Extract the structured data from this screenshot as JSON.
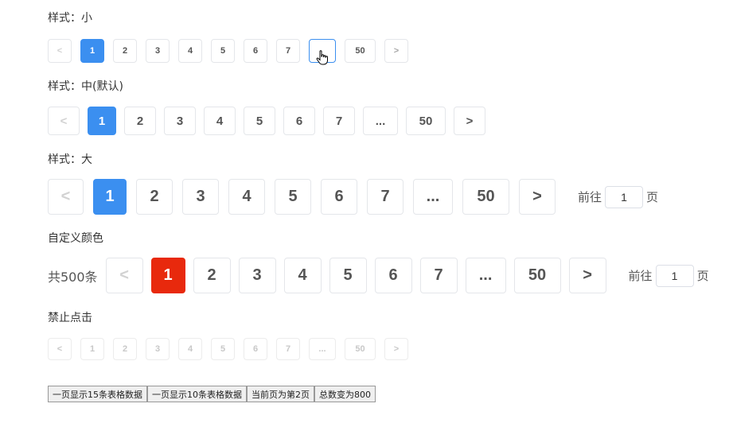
{
  "sections": {
    "small": {
      "label": "样式：小",
      "prev": "<",
      "next": ">",
      "pages": [
        "1",
        "2",
        "3",
        "4",
        "5",
        "6",
        "7",
        "",
        "50"
      ],
      "active": "1"
    },
    "medium": {
      "label": "样式：中(默认)",
      "prev": "<",
      "next": ">",
      "pages": [
        "1",
        "2",
        "3",
        "4",
        "5",
        "6",
        "7",
        "...",
        "50"
      ],
      "active": "1"
    },
    "large": {
      "label": "样式：大",
      "prev": "<",
      "next": ">",
      "pages": [
        "1",
        "2",
        "3",
        "4",
        "5",
        "6",
        "7",
        "...",
        "50"
      ],
      "active": "1",
      "goto_prefix": "前往",
      "goto_value": "1",
      "goto_suffix": "页"
    },
    "custom": {
      "label": "自定义颜色",
      "total": "共500条",
      "prev": "<",
      "next": ">",
      "pages": [
        "1",
        "2",
        "3",
        "4",
        "5",
        "6",
        "7",
        "...",
        "50"
      ],
      "active": "1",
      "active_color": "#e8290d",
      "goto_prefix": "前往",
      "goto_value": "1",
      "goto_suffix": "页"
    },
    "disabled": {
      "label": "禁止点击",
      "prev": "<",
      "next": ">",
      "pages": [
        "1",
        "2",
        "3",
        "4",
        "5",
        "6",
        "7",
        "...",
        "50"
      ]
    }
  },
  "colors": {
    "accent": "#3b8ff0",
    "custom_active": "#e8290d"
  },
  "buttons": [
    "一页显示15条表格数据",
    "一页显示10条表格数据",
    "当前页为第2页",
    "总数变为800"
  ]
}
